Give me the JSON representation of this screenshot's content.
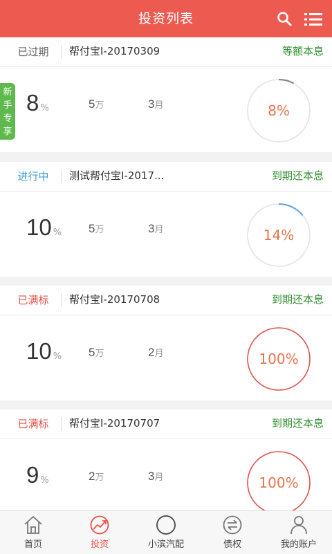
{
  "header": {
    "title": "投资列表",
    "search_icon": "search-icon",
    "menu_icon": "list-menu-icon"
  },
  "tag": {
    "label": "新手专享",
    "color": "#5fba4d"
  },
  "colors": {
    "brand": "#ec5a50",
    "ring_track": "#e6e6e6",
    "ring_progress_partial": "#6aa9e0",
    "ring_full": "#e0524a",
    "method": "#2f8f2f"
  },
  "products": [
    {
      "status": "已过期",
      "status_color": "#666666",
      "name": "帮付宝I-20170309",
      "method": "等额本息",
      "rate": "8",
      "rate_unit": "%",
      "amount": "5",
      "amount_unit": "万",
      "term": "3",
      "term_unit": "月",
      "progress": 8,
      "progress_label": "8%"
    },
    {
      "status": "进行中",
      "status_color": "#3a9fd8",
      "name": "测试帮付宝I-2017...",
      "method": "到期还本息",
      "rate": "10",
      "rate_unit": "%",
      "amount": "5",
      "amount_unit": "万",
      "term": "3",
      "term_unit": "月",
      "progress": 14,
      "progress_label": "14%"
    },
    {
      "status": "已满标",
      "status_color": "#e0524a",
      "name": "帮付宝I-20170708",
      "method": "到期还本息",
      "rate": "10",
      "rate_unit": "%",
      "amount": "5",
      "amount_unit": "万",
      "term": "2",
      "term_unit": "月",
      "progress": 100,
      "progress_label": "100%"
    },
    {
      "status": "已满标",
      "status_color": "#e0524a",
      "name": "帮付宝I-20170707",
      "method": "到期还本息",
      "rate": "9",
      "rate_unit": "%",
      "amount": "2",
      "amount_unit": "万",
      "term": "3",
      "term_unit": "月",
      "progress": 100,
      "progress_label": "100%"
    }
  ],
  "tabbar": [
    {
      "label": "首页",
      "icon": "home-icon",
      "active": false
    },
    {
      "label": "投资",
      "icon": "invest-chart-icon",
      "active": true
    },
    {
      "label": "小滨汽配",
      "icon": "circle-icon",
      "active": false
    },
    {
      "label": "债权",
      "icon": "transfer-icon",
      "active": false
    },
    {
      "label": "我的账户",
      "icon": "user-icon",
      "active": false
    }
  ]
}
